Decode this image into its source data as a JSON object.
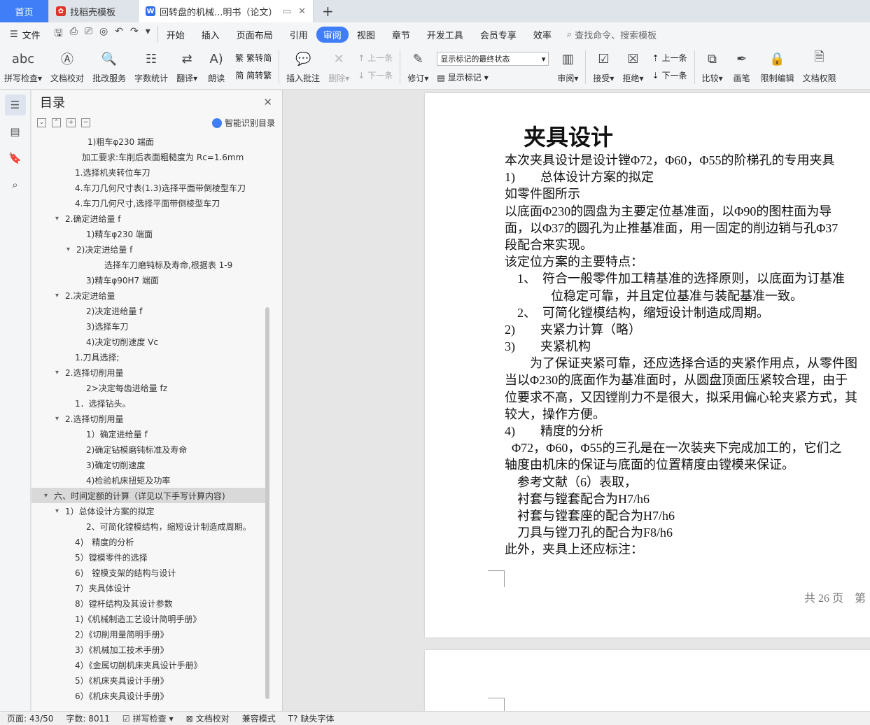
{
  "tabs": [
    {
      "label": "首页"
    },
    {
      "label": "找稻壳模板"
    },
    {
      "label": "回转盘的机械...明书（论文）"
    }
  ],
  "menu": {
    "file": "文件",
    "items": [
      "开始",
      "插入",
      "页面布局",
      "引用",
      "审阅",
      "视图",
      "章节",
      "开发工具",
      "会员专享",
      "效率"
    ],
    "active": "审阅",
    "search": "查找命令、搜索模板"
  },
  "ribbon": {
    "spellcheck": "拼写检查",
    "doc_check": "文档校对",
    "correction": "批改服务",
    "word_count": "字数统计",
    "translate": "翻译",
    "read_aloud": "朗读",
    "to_traditional": "繁转简",
    "to_simplified": "简转繁",
    "insert_comment": "插入批注",
    "delete": "删除",
    "prev_comment": "上一条",
    "next_comment": "下一条",
    "revise": "修订",
    "markup_state": "显示标记的最终状态",
    "show_markup": "显示标记",
    "review": "审阅",
    "accept": "接受",
    "reject": "拒绝",
    "prev_change": "上一条",
    "next_change": "下一条",
    "compare": "比较",
    "draw": "画笔",
    "restrict_edit": "限制编辑",
    "doc_permission": "文档权限"
  },
  "toc": {
    "title": "目录",
    "ai_button": "智能识别目录",
    "items": [
      {
        "text": "1)粗车φ230 端面",
        "indent": 80,
        "chev": false
      },
      {
        "text": "加工要求:车削后表面粗糙度为 Rc=1.6mm",
        "indent": 72,
        "chev": false
      },
      {
        "text": "1.选择机夹转位车刀",
        "indent": 62,
        "chev": false
      },
      {
        "text": "4.车刀几何尺寸表(1.3)选择平面带倒棱型车刀",
        "indent": 62,
        "chev": false
      },
      {
        "text": "4.车刀几何尺寸,选择平面带倒棱型车刀",
        "indent": 62,
        "chev": false
      },
      {
        "text": "2.确定进给量 f",
        "indent": 48,
        "chev": true
      },
      {
        "text": "1)精车φ230 端面",
        "indent": 78,
        "chev": false
      },
      {
        "text": "2)决定进给量 f",
        "indent": 64,
        "chev": true
      },
      {
        "text": "选择车刀磨钝标及寿命,根据表 1-9",
        "indent": 104,
        "chev": false
      },
      {
        "text": "3)精车φ90H7 端面",
        "indent": 78,
        "chev": false
      },
      {
        "text": "2.决定进给量",
        "indent": 48,
        "chev": true
      },
      {
        "text": "2)决定进给量 f",
        "indent": 78,
        "chev": false
      },
      {
        "text": "3)选择车刀",
        "indent": 78,
        "chev": false
      },
      {
        "text": "4)决定切削速度 Vc",
        "indent": 78,
        "chev": false
      },
      {
        "text": "1.刀具选择;",
        "indent": 62,
        "chev": false
      },
      {
        "text": "2.选择切削用量",
        "indent": 48,
        "chev": true
      },
      {
        "text": "2>决定每齿进给量 fz",
        "indent": 78,
        "chev": false
      },
      {
        "text": "1．选择钻头。",
        "indent": 62,
        "chev": false
      },
      {
        "text": "2.选择切削用量",
        "indent": 48,
        "chev": true
      },
      {
        "text": "1）确定进给量 f",
        "indent": 78,
        "chev": false
      },
      {
        "text": "2)确定钻模磨钝标准及寿命",
        "indent": 78,
        "chev": false
      },
      {
        "text": "3)确定切削速度",
        "indent": 78,
        "chev": false
      },
      {
        "text": "4)检验机床扭矩及功率",
        "indent": 78,
        "chev": false
      },
      {
        "text": "六、时间定额的计算（详见以下手写计算内容)",
        "indent": 32,
        "chev": true,
        "selected": true
      },
      {
        "text": "1）总体设计方案的拟定",
        "indent": 48,
        "chev": true
      },
      {
        "text": "2、可简化镗模结构，缩短设计制造成周期。",
        "indent": 78,
        "chev": false
      },
      {
        "text": "4)　精度的分析",
        "indent": 62,
        "chev": false
      },
      {
        "text": "5）镗模零件的选择",
        "indent": 62,
        "chev": false
      },
      {
        "text": "6)　镗模支架的结构与设计",
        "indent": 62,
        "chev": false
      },
      {
        "text": "7）夹具体设计",
        "indent": 62,
        "chev": false
      },
      {
        "text": "8）镗杆结构及其设计参数",
        "indent": 62,
        "chev": false
      },
      {
        "text": "1)《机械制造工艺设计简明手册》",
        "indent": 62,
        "chev": false
      },
      {
        "text": "2）《切削用量简明手册》",
        "indent": 62,
        "chev": false
      },
      {
        "text": "3）《机械加工技术手册》",
        "indent": 62,
        "chev": false
      },
      {
        "text": "4）《金属切削机床夹具设计手册》",
        "indent": 62,
        "chev": false
      },
      {
        "text": "5）《机床夹具设计手册》",
        "indent": 62,
        "chev": false
      },
      {
        "text": "6）《机床夹具设计手册》",
        "indent": 62,
        "chev": false
      }
    ]
  },
  "document": {
    "title": "夹具设计",
    "lines": [
      {
        "text": "本次夹具设计是设计镗Φ72，Φ60，Φ55的阶梯孔的专用夹具",
        "indent": 0
      },
      {
        "text": "1)　　总体设计方案的拟定",
        "indent": 0
      },
      {
        "text": "如零件图所示",
        "indent": 0
      },
      {
        "text": "以底面Φ230的圆盘为主要定位基准面，以Φ90的图柱面为导",
        "indent": 0
      },
      {
        "text": "面，以Φ37的圆孔为止推基准面，用一固定的削边销与孔Φ37",
        "indent": 0
      },
      {
        "text": "段配合来实现。",
        "indent": 0
      },
      {
        "text": "该定位方案的主要特点：",
        "indent": 0
      },
      {
        "text": "1、　符合一般零件加工精基准的选择原则，以底面为订基准",
        "indent": 18
      },
      {
        "text": "位稳定可靠，并且定位基准与装配基准一致。",
        "indent": 66
      },
      {
        "text": "2、　可简化镗模结构，缩短设计制造成周期。",
        "indent": 18
      },
      {
        "text": "2)　　夹紧力计算（略）",
        "indent": 0
      },
      {
        "text": "3)　　夹紧机构",
        "indent": 0
      },
      {
        "text": "为了保证夹紧可靠，还应选择合适的夹紧作用点，从零件图",
        "indent": 36
      },
      {
        "text": "当以Φ230的底面作为基准面时，从圆盘顶面压紧较合理，由于",
        "indent": 0
      },
      {
        "text": "位要求不高，又因镗削力不是很大，拟采用偏心轮夹紧方式，其",
        "indent": 0
      },
      {
        "text": "较大，操作方便。",
        "indent": 0
      },
      {
        "text": "4)　　精度的分析",
        "indent": 0
      },
      {
        "text": "Φ72，Φ60，Φ55的三孔是在一次装夹下完成加工的，它们之",
        "indent": 10
      },
      {
        "text": "轴度由机床的保证与底面的位置精度由镗模来保证。",
        "indent": 0
      },
      {
        "text": "参考文献（6）表取，",
        "indent": 18
      },
      {
        "text": "衬套与镗套配合为H7/h6",
        "indent": 18
      },
      {
        "text": "衬套与镗套座的配合为H7/h6",
        "indent": 18
      },
      {
        "text": "刀具与镗刀孔的配合为F8/h6",
        "indent": 18
      },
      {
        "text": "此外，夹具上还应标注：",
        "indent": 0
      }
    ],
    "footer": "共 26 页　第"
  },
  "status": {
    "page": "页面: 43/50",
    "words": "字数: 8011",
    "spellcheck": "拼写检查",
    "doc_check": "文档校对",
    "compat": "兼容模式",
    "missing_font": "缺失字体"
  },
  "colors": {
    "accent": "#3f7ef6"
  }
}
